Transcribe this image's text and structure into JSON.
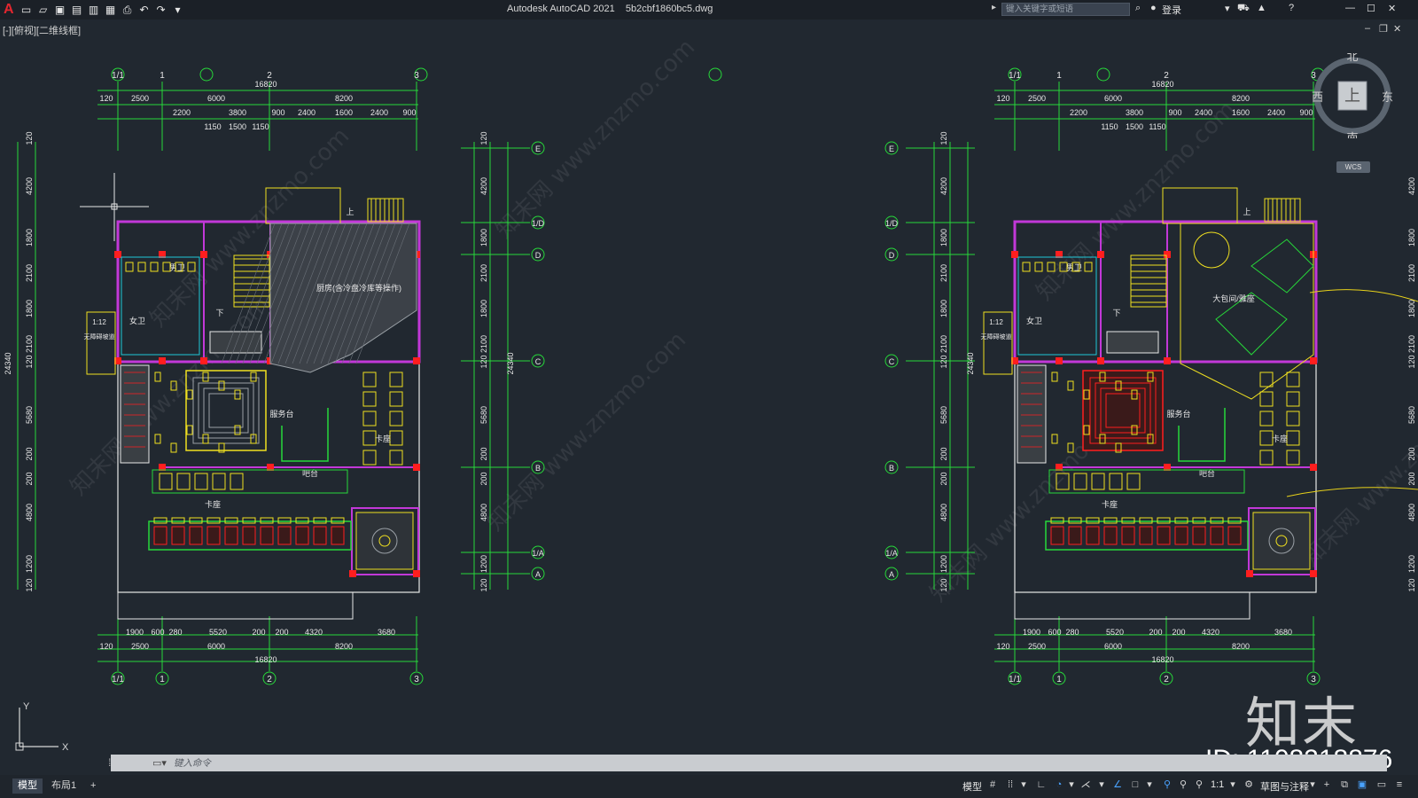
{
  "titlebar": {
    "app_title": "Autodesk AutoCAD 2021    5b2cbf1860bc5.dwg",
    "search_placeholder": "键入关键字或短语",
    "login_label": "登录"
  },
  "viewport": {
    "label": "[-][俯视][二维线框]"
  },
  "viewcube": {
    "north": "北",
    "south": "南",
    "east": "东",
    "west": "西",
    "face": "上",
    "wcs": "WCS"
  },
  "plans": {
    "grid_top": [
      "1/1",
      "1",
      "2",
      "3"
    ],
    "grid_side": [
      "E",
      "1/D",
      "D",
      "C",
      "B",
      "1/A",
      "A"
    ],
    "dim_total": "16820",
    "dim_row1": [
      "120",
      "2500",
      "6000",
      "8200"
    ],
    "dim_row2": [
      "2200",
      "3800",
      "900",
      "2400",
      "1600",
      "2400",
      "900"
    ],
    "dim_row3": [
      "1150",
      "1500",
      "1150"
    ],
    "dim_bottom1": [
      "1900",
      "600",
      "280",
      "5520",
      "200",
      "200",
      "4320",
      "3680"
    ],
    "dim_bottom2": [
      "120",
      "2500",
      "6000",
      "8200"
    ],
    "dim_vertical_total": "24340",
    "dim_vertical": [
      "120",
      "4200",
      "1800",
      "2100",
      "1800",
      "2100",
      "120",
      "5680",
      "200",
      "200",
      "4800",
      "1200",
      "120"
    ],
    "room_kitchen": "厨房(含冷盘冷库等操作)",
    "room_private": "大包间/雅座",
    "label_up": "上",
    "label_down": "下",
    "label_ramp": "1:12",
    "label_booth": "卡座",
    "label_bar": "吧台",
    "label_reception": "服务台",
    "label_female_wc": "女卫",
    "label_male_wc": "男卫",
    "label_accessible": "无障碍坡道"
  },
  "watermark": {
    "brand": "知末",
    "id_text": "ID: 1108218876",
    "diag_text": "知末网 www.znzmo.com"
  },
  "commandline": {
    "placeholder": "键入命令"
  },
  "tabs": [
    "模型",
    "布局1"
  ],
  "statusbar": {
    "model": "模型",
    "scale": "1:1",
    "workspace": "草图与注释"
  }
}
